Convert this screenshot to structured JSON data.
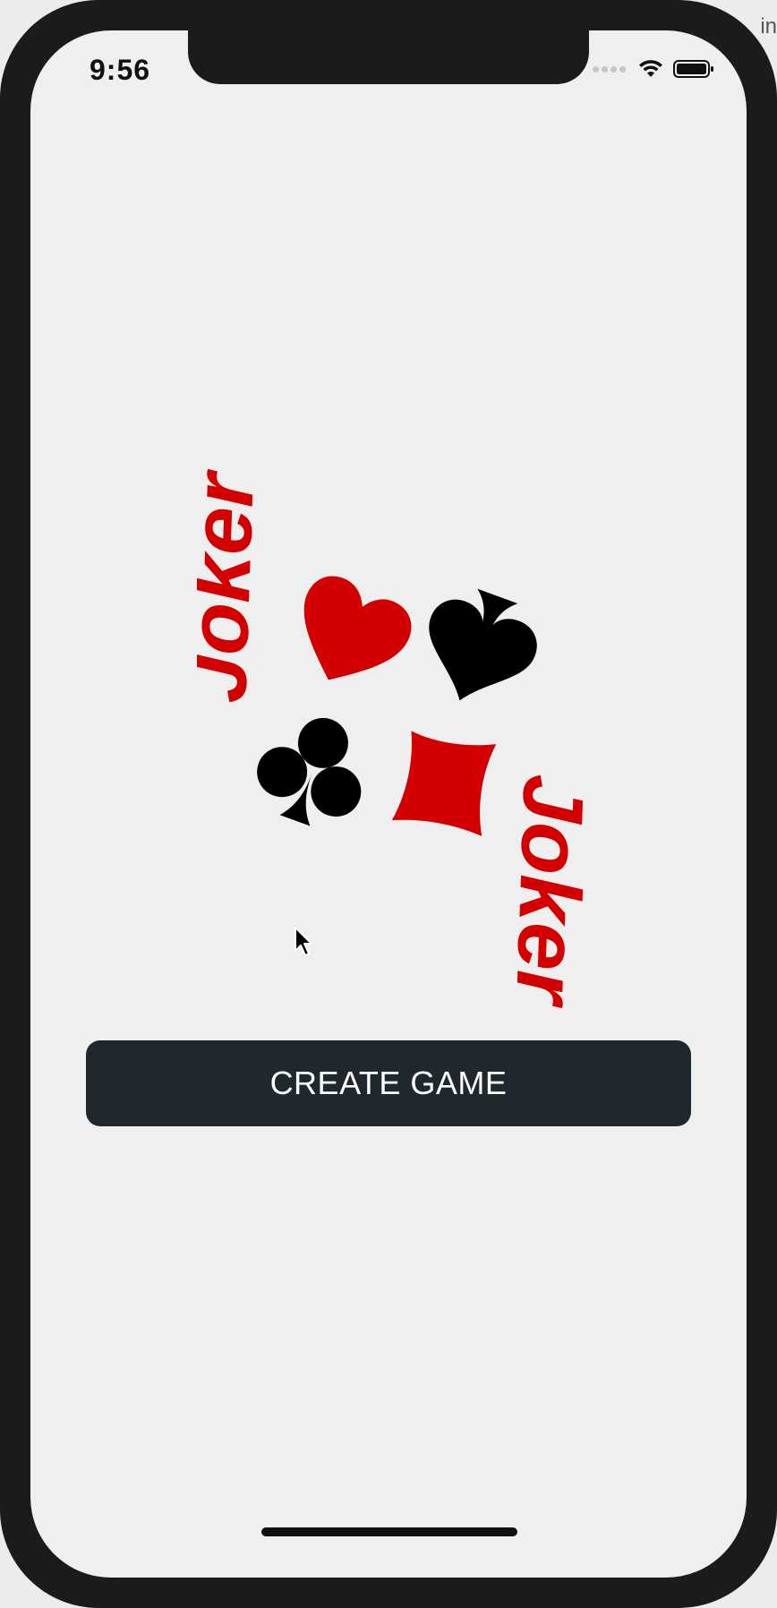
{
  "status_bar": {
    "time": "9:56"
  },
  "corner_text": "in",
  "logo": {
    "word": "Joker",
    "colors": {
      "red": "#d20000",
      "black": "#000000"
    },
    "suits": [
      "heart-icon",
      "spade-icon",
      "club-icon",
      "diamond-icon"
    ]
  },
  "actions": {
    "create_game_label": "CREATE GAME"
  },
  "colors": {
    "button_bg": "#1f282d",
    "screen_bg": "#efefef",
    "frame": "#1b1b1b"
  }
}
